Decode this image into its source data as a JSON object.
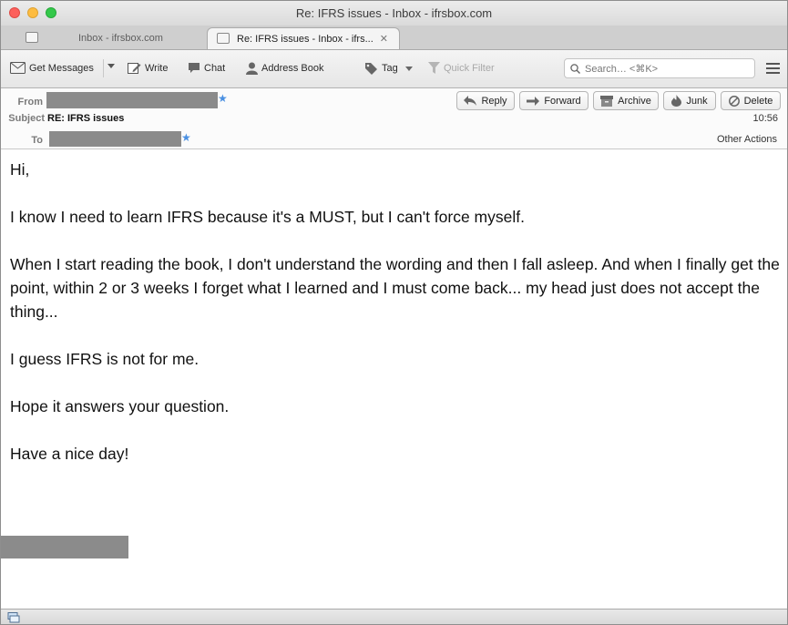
{
  "window": {
    "title": "Re: IFRS issues - Inbox - ifrsbox.com"
  },
  "tabs": [
    {
      "label": "Inbox - ifrsbox.com",
      "active": false
    },
    {
      "label": "Re: IFRS issues - Inbox - ifrs...",
      "active": true
    }
  ],
  "toolbar": {
    "get_messages": "Get Messages",
    "write": "Write",
    "chat": "Chat",
    "address_book": "Address Book",
    "tag": "Tag",
    "quick_filter": "Quick Filter",
    "search_placeholder": "Search… <⌘K>"
  },
  "header": {
    "from_label": "From",
    "subject_label": "Subject",
    "subject": "RE: IFRS issues",
    "to_label": "To",
    "time": "10:56",
    "other_actions": "Other Actions",
    "buttons": {
      "reply": "Reply",
      "forward": "Forward",
      "archive": "Archive",
      "junk": "Junk",
      "delete": "Delete"
    }
  },
  "body": {
    "paragraphs": [
      "Hi,",
      "I know I need to learn IFRS because it's a MUST, but I can't force myself.",
      "When I start reading the book, I don't understand the wording and then I fall asleep. And when I finally get the point, within 2 or 3 weeks I forget what I learned and I must come back... my head just does not accept the thing...",
      "I guess IFRS is not for me.",
      "Hope it answers your question.",
      "Have a nice day!"
    ]
  },
  "colors": {
    "accent_star": "#4a90e2",
    "redaction": "#8b8b8b",
    "close": "#fc605c",
    "minimize": "#fdbc40",
    "maximize": "#34c84a"
  }
}
